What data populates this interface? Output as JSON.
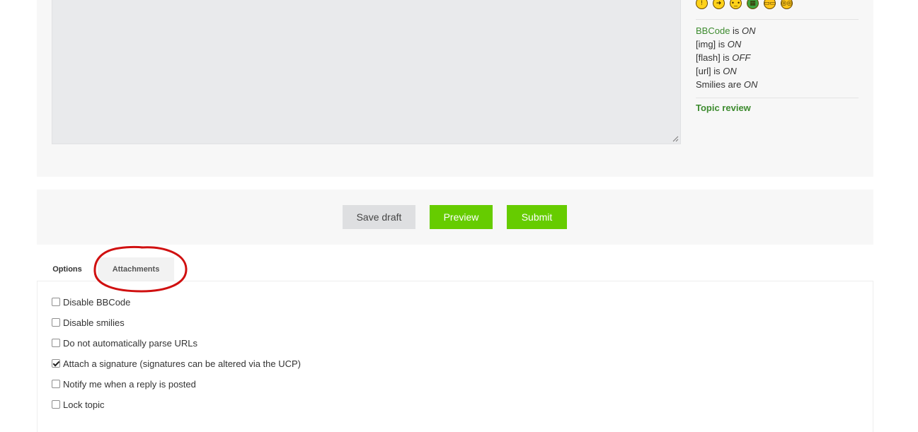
{
  "sidebar": {
    "smilies": [
      {
        "icon": "idea-smiley-icon",
        "glyph": "!",
        "color": "#ffd21a"
      },
      {
        "icon": "arrow-smiley-icon",
        "glyph": "➜",
        "color": "#ffd21a"
      },
      {
        "icon": "neutral-smiley-icon",
        "glyph": "•_•",
        "color": "#ffd21a"
      },
      {
        "icon": "green-grin-smiley-icon",
        "glyph": "▦",
        "color": "#3fa33f"
      },
      {
        "icon": "cool-smiley-icon",
        "glyph": "▭▭",
        "color": "#ffc61a"
      },
      {
        "icon": "glasses-smiley-icon",
        "glyph": "◎◎",
        "color": "#ffc61a"
      }
    ],
    "status": {
      "bbcode_link": "BBCode",
      "bbcode_text": " is ",
      "bbcode_state": "ON",
      "img_text": "[img] is ",
      "img_state": "ON",
      "flash_text": "[flash] is ",
      "flash_state": "OFF",
      "url_text": "[url] is ",
      "url_state": "ON",
      "smilies_text": "Smilies are ",
      "smilies_state": "ON"
    },
    "topic_review": "Topic review"
  },
  "buttons": {
    "save_draft": "Save draft",
    "preview": "Preview",
    "submit": "Submit"
  },
  "tabs": {
    "options": "Options",
    "attachments": "Attachments"
  },
  "options": [
    {
      "label": "Disable BBCode",
      "checked": false
    },
    {
      "label": "Disable smilies",
      "checked": false
    },
    {
      "label": "Do not automatically parse URLs",
      "checked": false
    },
    {
      "label": "Attach a signature (signatures can be altered via the UCP)",
      "checked": true
    },
    {
      "label": "Notify me when a reply is posted",
      "checked": false
    },
    {
      "label": "Lock topic",
      "checked": false
    }
  ],
  "colors": {
    "accent_green": "#66cc00",
    "link_green": "#3d8b2f",
    "annotation_red": "#d01010"
  }
}
